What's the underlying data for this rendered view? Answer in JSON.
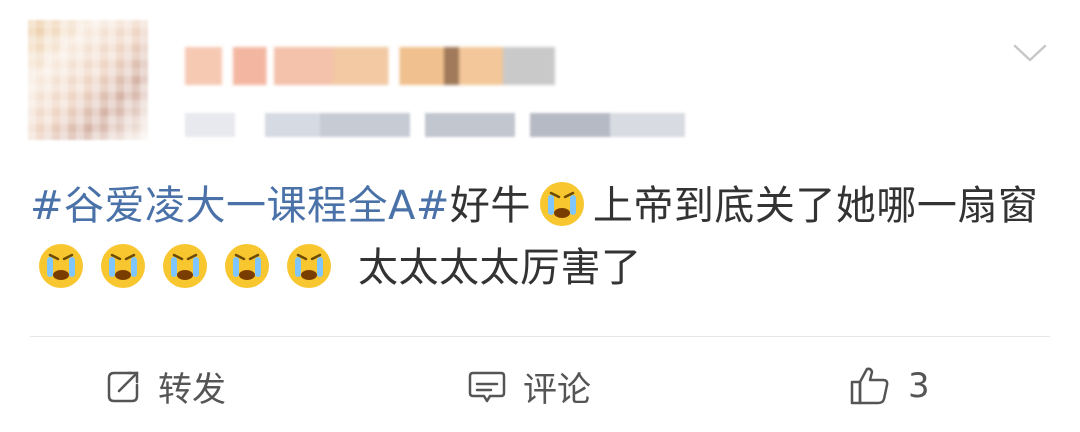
{
  "post": {
    "hashtag": "#谷爱凌大一课程全A#",
    "text_part1": "好牛",
    "text_part2": "上帝到底关了她哪一扇窗",
    "text_part3": "太太太太厉害了"
  },
  "footer": {
    "repost_label": "转发",
    "comment_label": "评论",
    "like_count": "3"
  }
}
